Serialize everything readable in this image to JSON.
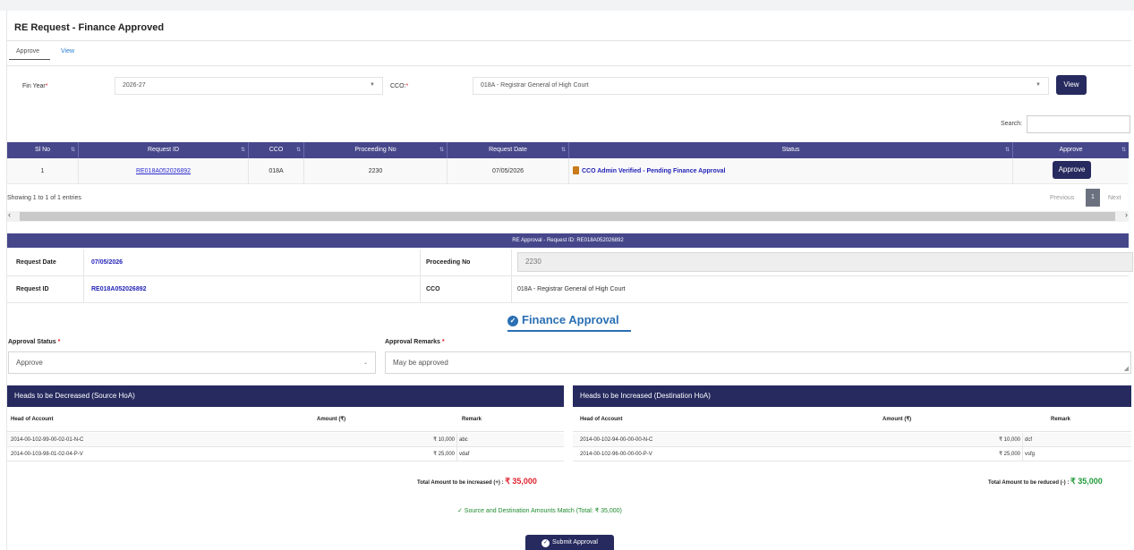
{
  "card": {
    "title": "RE Request - Finance Approved"
  },
  "tabs": {
    "approve": "Approve",
    "view": "View"
  },
  "filters": {
    "fin_year_label": "Fin Year",
    "fin_year_required": "*",
    "fin_year_value": "2026-27",
    "cco_label": "CCO:",
    "cco_required": "*",
    "cco_value": "018A - Registrar General of High Court",
    "view_button": "View",
    "search_label": "Search:",
    "search_value": ""
  },
  "list_table": {
    "headers": [
      "Sl No",
      "Request ID",
      "CCO",
      "Proceeding No",
      "Request Date",
      "Status",
      "Approve"
    ],
    "rows": [
      {
        "sl_no": "1",
        "request_id": "RE018A052026892",
        "cco": "018A",
        "proceeding_no": "2230",
        "request_date": "07/05/2026",
        "status": "CCO Admin Verified - Pending Finance Approval",
        "approve_button": "Approve"
      }
    ],
    "showing_text": "Showing 1 to 1 of 1 entries",
    "pagination": {
      "previous": "Previous",
      "current": "1",
      "next": "Next"
    }
  },
  "detail": {
    "header": "RE Approval - Request ID: RE018A052026892",
    "request_date_label": "Request Date",
    "request_date_value": "07/05/2026",
    "proceeding_no_label": "Proceeding No",
    "proceeding_no_value": "2230",
    "request_id_label": "Request ID",
    "request_id_value": "RE018A052026892",
    "cco_label": "CCO",
    "cco_value": "018A - Registrar General of High Court"
  },
  "finance_approval": {
    "title": "Finance Approval",
    "approval_status_label": "Approval Status",
    "approval_status_value": "Approve",
    "approval_remarks_label": "Approval Remarks",
    "approval_remarks_value": "May be approved",
    "required_mark": "*"
  },
  "source_table": {
    "title": "Heads to be Decreased (Source HoA)",
    "headers": [
      "Head of Account",
      "Amount (₹)",
      "Remark"
    ],
    "rows": [
      {
        "head": "2014-00-102-99-00-02-01-N-C",
        "amount": "₹ 10,000",
        "remark": "abc"
      },
      {
        "head": "2014-00-103-98-01-02-04-P-V",
        "amount": "₹ 25,000",
        "remark": "vdaf"
      }
    ],
    "total_label": "Total Amount to be increased (+) :",
    "total_value": "₹ 35,000"
  },
  "destination_table": {
    "title": "Heads to be Increased (Destination HoA)",
    "headers": [
      "Head of Account",
      "Amount (₹)",
      "Remark"
    ],
    "rows": [
      {
        "head": "2014-00-102-94-00-00-00-N-C",
        "amount": "₹ 10,000",
        "remark": "dcf"
      },
      {
        "head": "2014-00-102-96-00-00-00-P-V",
        "amount": "₹ 25,000",
        "remark": "vsfg"
      }
    ],
    "total_label": "Total Amount to be reduced (-) :",
    "total_value": "₹ 35,000"
  },
  "match_message": "✓ Source and Destination Amounts Match (Total: ₹ 35,000)",
  "submit_button": "Submit Approval",
  "colors": {
    "header_purple": "#46478a",
    "button_navy": "#262a5e",
    "link_blue": "#2323b8",
    "accent_blue": "#2a6fb3",
    "required_red": "#e0222e",
    "success_green": "#1f8a2e"
  }
}
